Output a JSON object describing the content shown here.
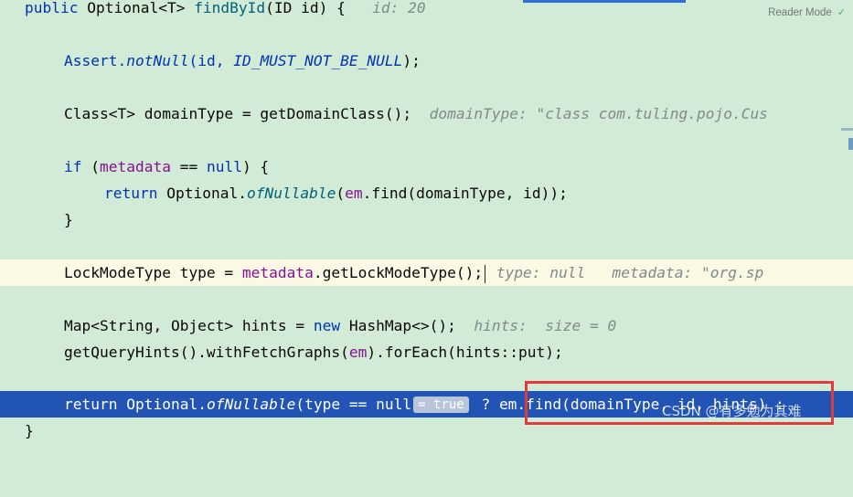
{
  "reader_mode": {
    "label": "Reader Mode"
  },
  "lines": {
    "l1": {
      "kw": "public ",
      "type": "Optional<T> ",
      "name": "findById",
      "args": "(ID id) {",
      "hint": "id: 20"
    },
    "l2": {
      "cls": "Assert.",
      "method": "notNull",
      "open": "(id, ",
      "constant": "ID_MUST_NOT_BE_NULL",
      "close": ");"
    },
    "l3": {
      "code": "Class<T> domainType = getDomainClass();",
      "hint": "domainType: \"class com.tuling.pojo.Cus"
    },
    "l4": {
      "kw": "if ",
      "open": "(",
      "field": "metadata",
      "mid": " == ",
      "kw2": "null",
      "close": ") {"
    },
    "l5": {
      "kw": "return ",
      "cls": "Optional.",
      "method": "ofNullable",
      "open": "(",
      "field": "em",
      "rest": ".find(domainType, id));"
    },
    "l6": {
      "code": "}"
    },
    "l7": {
      "pre": "LockModeType type = ",
      "field": "metadata",
      "rest": ".getLockModeType();",
      "hint1": "type: null",
      "hint2": "metadata: \"org.sp"
    },
    "l8": {
      "pre": "Map<String, Object> hints = ",
      "kw": "new ",
      "rest": "HashMap<>();",
      "hint": "hints:  size = 0"
    },
    "l9": {
      "pre": "getQueryHints().withFetchGraphs(",
      "field": "em",
      "rest": ").forEach(hints::put);"
    },
    "l10": {
      "kw": "return ",
      "cls": "Optional.",
      "method": "ofNullable",
      "pre": "(type == null",
      "badge": "= true",
      "rest": " ? em.find(domainType, id, hints) :"
    },
    "l11": {
      "code": "}"
    }
  },
  "watermark": {
    "text": "CSDN @有多勉为其难"
  },
  "colors": {
    "background": "#d2ebd6",
    "current_line": "#fbf8e4",
    "selection": "#2154b5",
    "keyword": "#0033b3",
    "field": "#871094",
    "highlight_box": "#e33b3b"
  }
}
